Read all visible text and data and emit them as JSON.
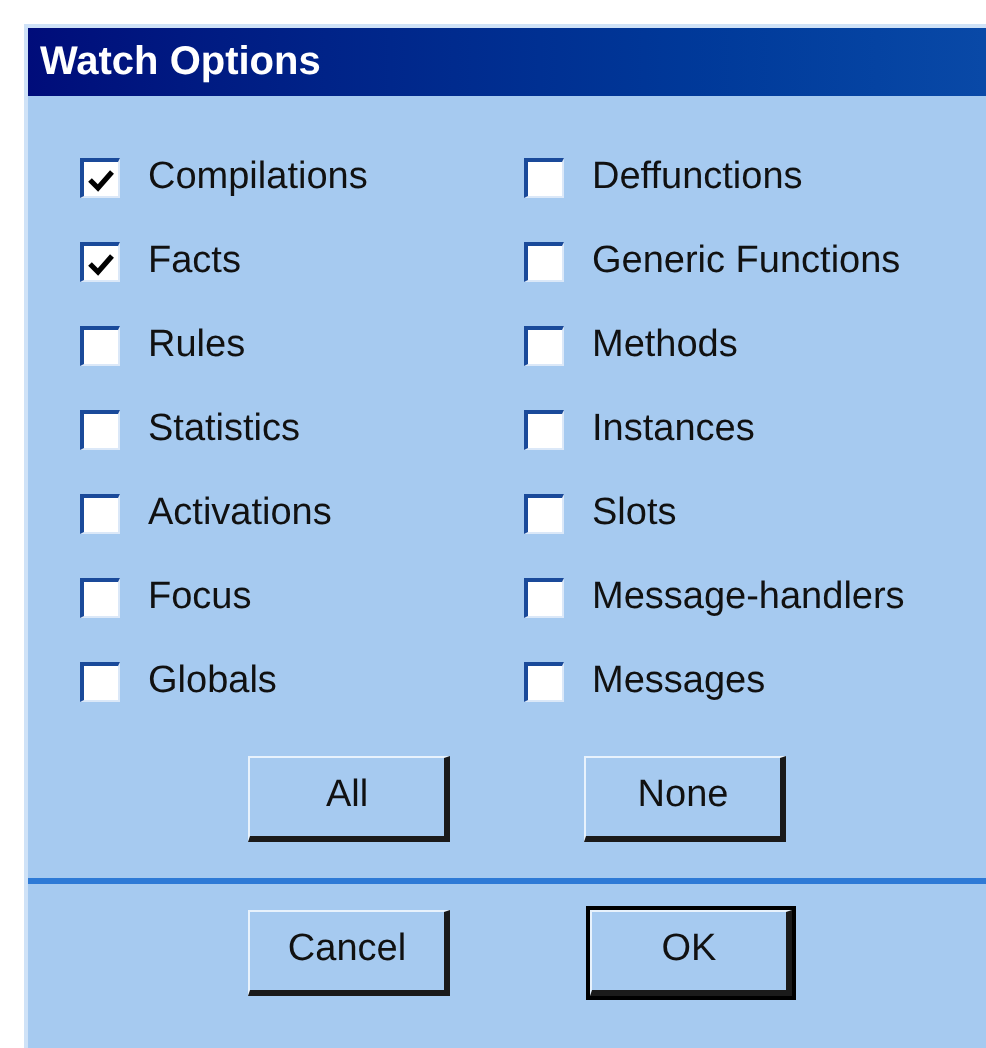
{
  "window": {
    "title": "Watch Options"
  },
  "columns": [
    [
      {
        "label": "Compilations",
        "checked": true
      },
      {
        "label": "Facts",
        "checked": true
      },
      {
        "label": "Rules",
        "checked": false
      },
      {
        "label": "Statistics",
        "checked": false
      },
      {
        "label": "Activations",
        "checked": false
      },
      {
        "label": "Focus",
        "checked": false
      },
      {
        "label": "Globals",
        "checked": false
      }
    ],
    [
      {
        "label": "Deffunctions",
        "checked": false
      },
      {
        "label": "Generic Functions",
        "checked": false
      },
      {
        "label": "Methods",
        "checked": false
      },
      {
        "label": "Instances",
        "checked": false
      },
      {
        "label": "Slots",
        "checked": false
      },
      {
        "label": "Message-handlers",
        "checked": false
      },
      {
        "label": "Messages",
        "checked": false
      }
    ]
  ],
  "select_buttons": [
    {
      "label": "All",
      "default": false
    },
    {
      "label": "None",
      "default": false
    }
  ],
  "dialog_buttons": [
    {
      "label": "Cancel",
      "default": false
    },
    {
      "label": "OK",
      "default": true
    }
  ]
}
